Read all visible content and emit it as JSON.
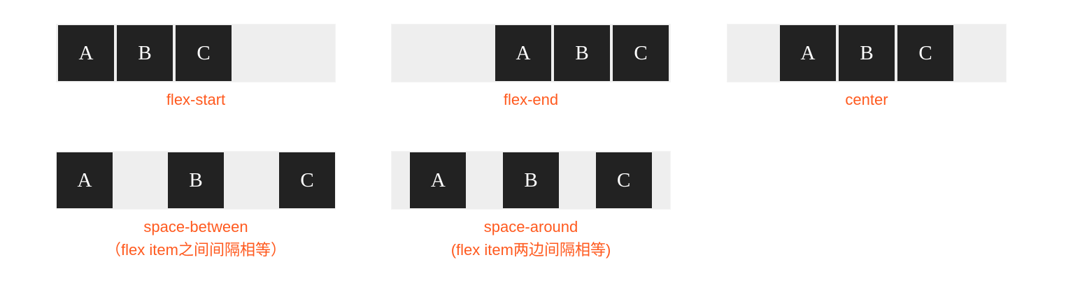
{
  "items": [
    "A",
    "B",
    "C"
  ],
  "demos": [
    {
      "caption": "flex-start",
      "sub": ""
    },
    {
      "caption": "flex-end",
      "sub": ""
    },
    {
      "caption": "center",
      "sub": ""
    },
    {
      "caption": "space-between",
      "sub": "（flex item之间间隔相等）"
    },
    {
      "caption": "space-around",
      "sub": "(flex item两边间隔相等)"
    }
  ],
  "colors": {
    "item_bg": "#222222",
    "track_bg": "#eeeeee",
    "caption": "#ff5a1f"
  }
}
